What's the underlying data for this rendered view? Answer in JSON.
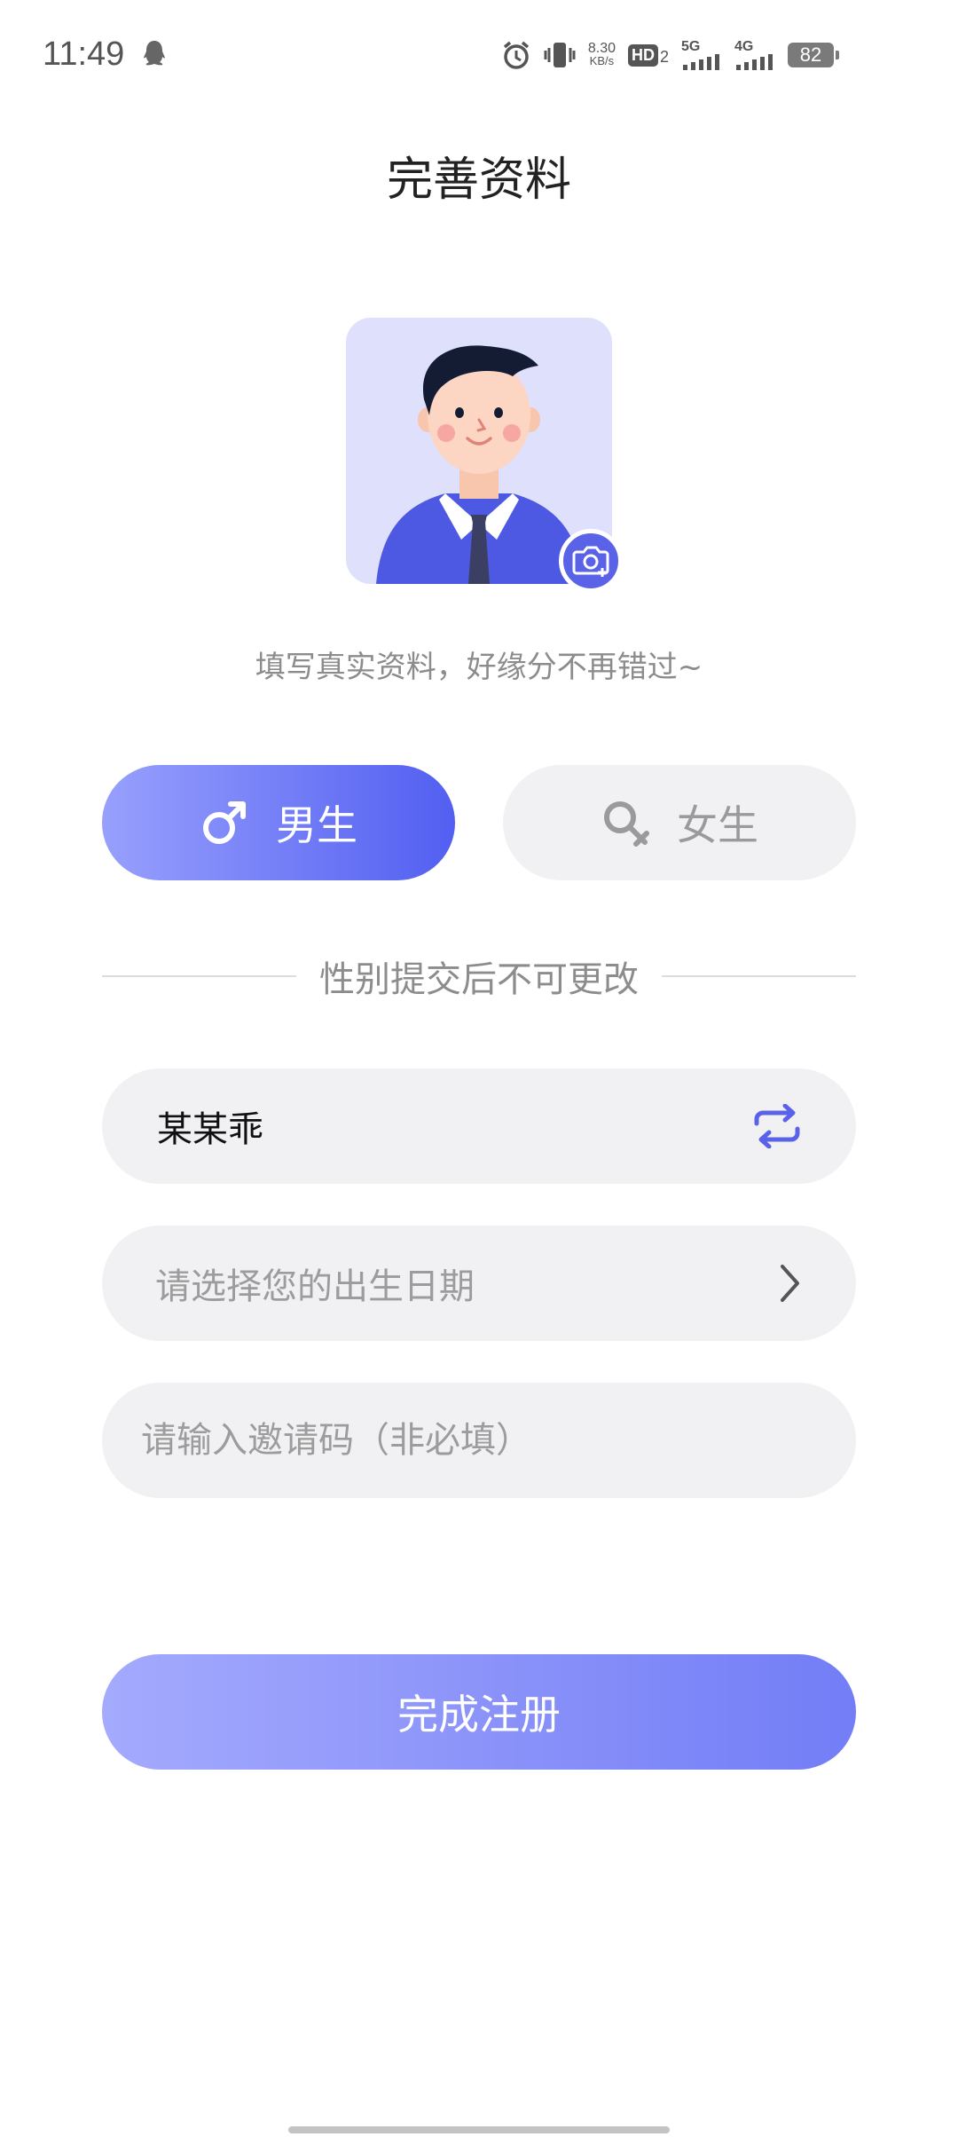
{
  "status_bar": {
    "time": "11:49",
    "network_speed_value": "8.30",
    "network_speed_unit": "KB/s",
    "hd_label": "HD",
    "sim_label": "2",
    "signal_1_label": "5G",
    "signal_2_label": "4G",
    "battery": "82"
  },
  "header": {
    "title": "完善资料"
  },
  "profile": {
    "subtitle": "填写真实资料，好缘分不再错过~"
  },
  "gender": {
    "male_label": "男生",
    "female_label": "女生",
    "selected": "male",
    "note": "性别提交后不可更改"
  },
  "form": {
    "nickname_value": "某某乖",
    "birthday_placeholder": "请选择您的出生日期",
    "invite_placeholder": "请输入邀请码（非必填）"
  },
  "actions": {
    "submit_label": "完成注册"
  },
  "colors": {
    "accent": "#5A63E8",
    "male_gradient_start": "#98A0FD",
    "male_gradient_end": "#525FF1",
    "field_bg": "#F1F1F4",
    "avatar_bg": "#DFE0FB"
  }
}
